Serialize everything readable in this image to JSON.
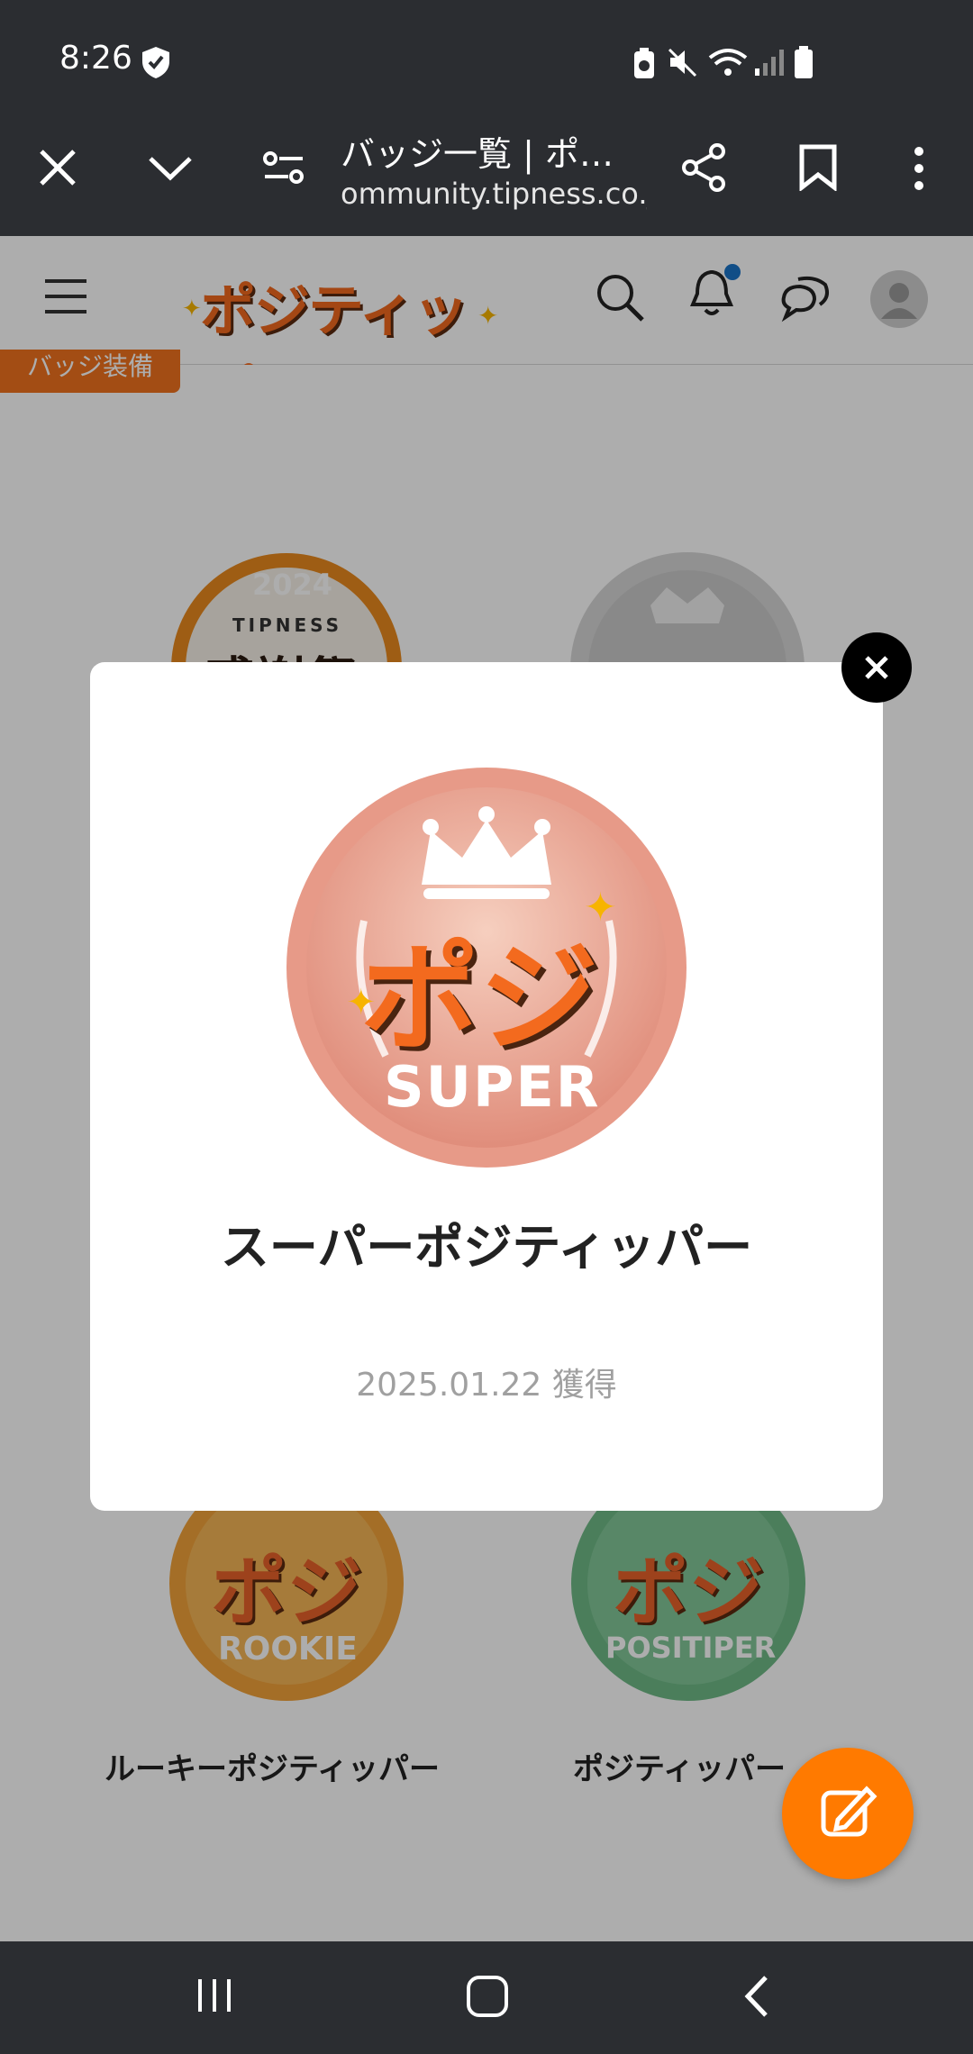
{
  "status_bar": {
    "time": "8:26",
    "icons": [
      "shield-check-icon",
      "battery-saver-icon",
      "mute-icon",
      "wifi-icon",
      "signal-icon",
      "battery-icon"
    ]
  },
  "browser": {
    "tab_title": "バッジ一覧 | ポ…",
    "url": "ommunity.tipness.co.jp",
    "icons": [
      "close-icon",
      "chevron-down-icon",
      "site-settings-icon",
      "share-icon",
      "bookmark-icon",
      "more-vert-icon"
    ]
  },
  "site": {
    "logo_text": "ポジティップ",
    "header_icons": [
      "menu-icon",
      "search-icon",
      "bell-icon",
      "chat-icon",
      "avatar"
    ],
    "equip_button": "バッジ装備"
  },
  "badges": [
    {
      "label": "ルーキーポジティッパー",
      "sub": "ROOKIE",
      "color": "#f2a23a"
    },
    {
      "label": "ポジティッパー",
      "sub": "POSITIPER",
      "color": "#6fba87"
    }
  ],
  "behind_badges": {
    "event_badge": {
      "year": "2024",
      "brand": "TIPNESS",
      "text": "感謝祭"
    }
  },
  "modal": {
    "badge_main": "ポジ",
    "badge_sub": "SUPER",
    "title": "スーパーポジティッパー",
    "acquired": "2025.01.22 獲得"
  },
  "colors": {
    "accent": "#ff7a00",
    "dark_bar": "#2b2d31",
    "super_badge": "#e9a08e"
  }
}
